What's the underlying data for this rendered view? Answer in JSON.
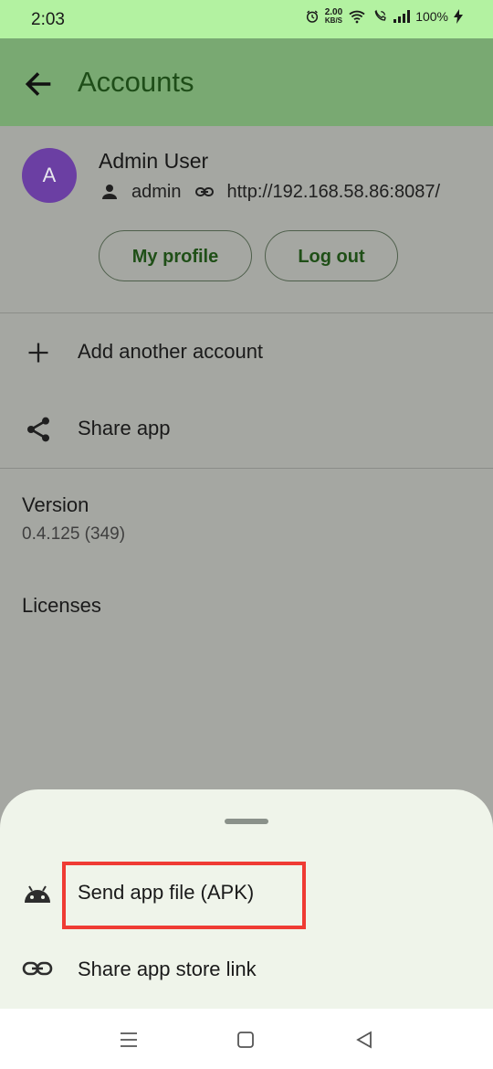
{
  "status_bar": {
    "time": "2:03",
    "speed_value": "2.00",
    "speed_unit": "KB/S",
    "battery": "100%"
  },
  "appbar": {
    "title": "Accounts",
    "back_icon": "arrow-back-icon"
  },
  "account": {
    "avatar_letter": "A",
    "name": "Admin User",
    "username": "admin",
    "server_url": "http://192.168.58.86:8087/",
    "profile_button": "My profile",
    "logout_button": "Log out"
  },
  "menu": {
    "add_account": "Add another account",
    "share_app": "Share app"
  },
  "about": {
    "version_title": "Version",
    "version_value": "0.4.125 (349)",
    "licenses": "Licenses"
  },
  "bottom_sheet": {
    "send_apk": "Send app file (APK)",
    "share_store_link": "Share app store link"
  },
  "colors": {
    "status_bar": "#b3f2a1",
    "app_bar": "#79a972",
    "accent": "#1e4d18",
    "avatar": "#6b3fa3",
    "highlight": "#ef3b34"
  }
}
